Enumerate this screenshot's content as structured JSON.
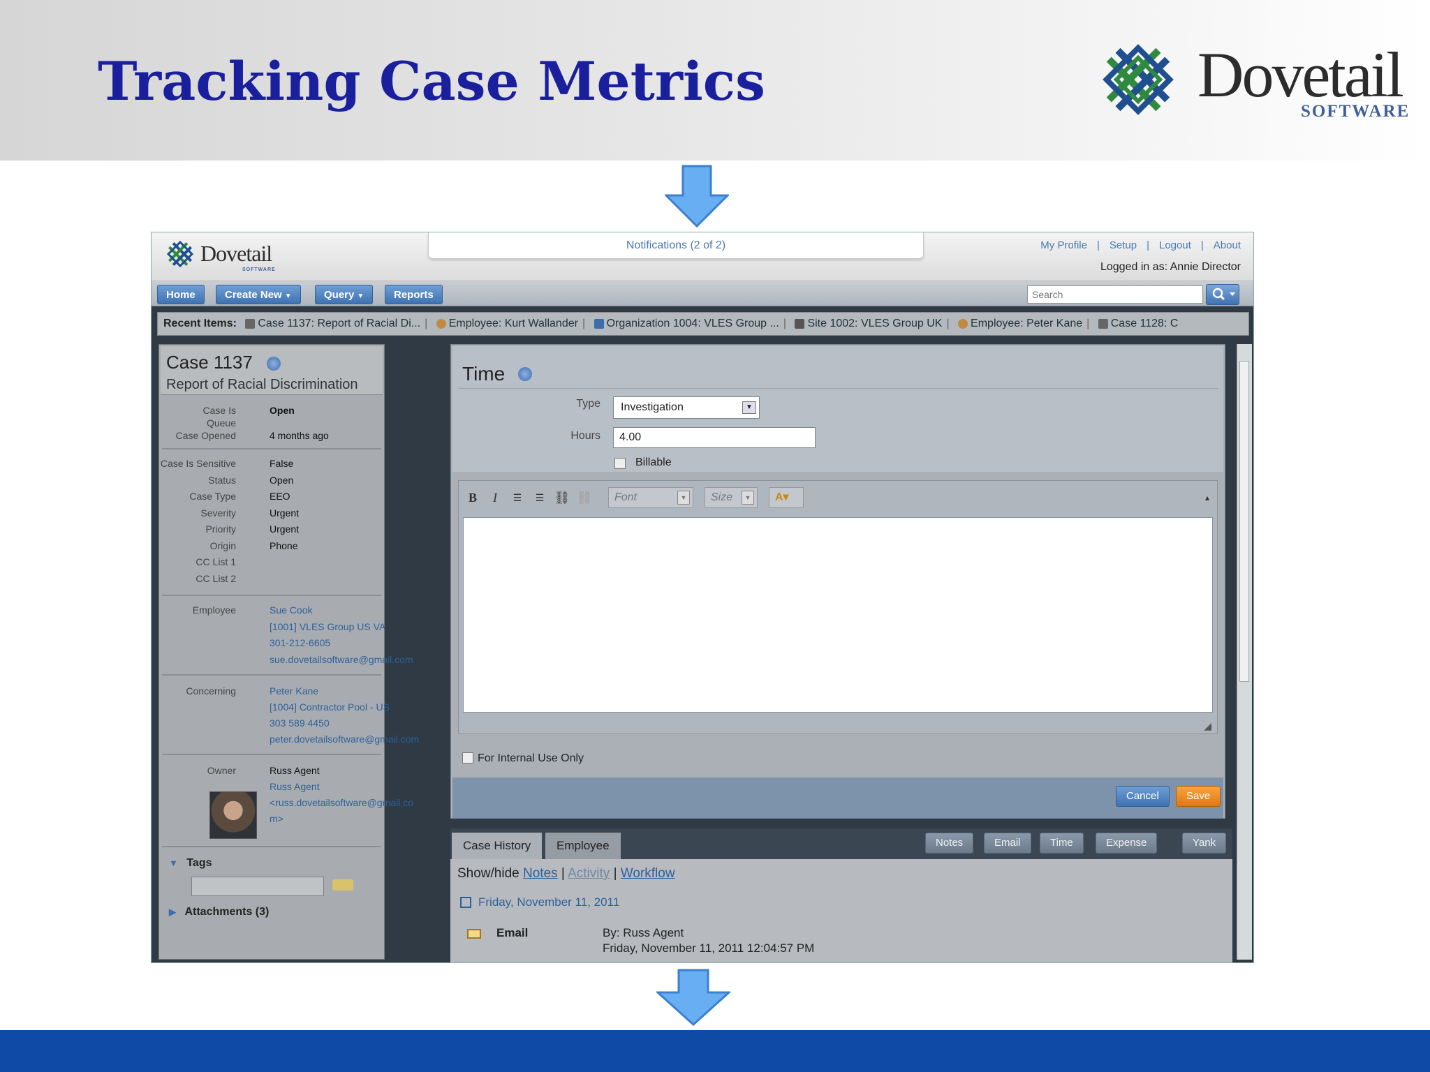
{
  "slide": {
    "title": "Tracking Case Metrics",
    "logo": {
      "name": "Dovetail",
      "sub": "SOFTWARE"
    },
    "colors": {
      "title": "#1a1f9e",
      "footer": "#0f4aa7",
      "arrow": "#5aa2ee"
    }
  },
  "app": {
    "logo": {
      "name": "Dovetail",
      "sub": "SOFTWARE"
    },
    "notifications": "Notifications (2 of 2)",
    "top_links": [
      "My Profile",
      "Setup",
      "Logout",
      "About"
    ],
    "logged_in": "Logged in as: Annie Director",
    "nav": {
      "home": "Home",
      "create_new": "Create New",
      "query": "Query",
      "reports": "Reports"
    },
    "search_placeholder": "Search",
    "recent": {
      "label": "Recent Items:",
      "items": [
        "Case 1137: Report of Racial Di...",
        "Employee: Kurt Wallander",
        "Organization 1004: VLES Group ...",
        "Site 1002: VLES Group UK",
        "Employee: Peter Kane",
        "Case 1128: C"
      ]
    },
    "case": {
      "number": "Case 1137",
      "title": "Report of Racial Discrimination",
      "fields": [
        {
          "k": "Case Is",
          "v": "Open"
        },
        {
          "k": "Queue",
          "v": ""
        },
        {
          "k": "Case Opened",
          "v": "4 months ago"
        },
        {
          "k": "Case Is Sensitive",
          "v": "False"
        },
        {
          "k": "Status",
          "v": "Open"
        },
        {
          "k": "Case Type",
          "v": "EEO"
        },
        {
          "k": "Severity",
          "v": "Urgent"
        },
        {
          "k": "Priority",
          "v": "Urgent"
        },
        {
          "k": "Origin",
          "v": "Phone"
        },
        {
          "k": "CC List 1",
          "v": ""
        },
        {
          "k": "CC List 2",
          "v": ""
        }
      ],
      "employee": {
        "label": "Employee",
        "lines": [
          "Sue Cook",
          "[1001] VLES Group US VA",
          "301-212-6605",
          "sue.dovetailsoftware@gmail.com"
        ]
      },
      "concerning": {
        "label": "Concerning",
        "lines": [
          "Peter Kane",
          "[1004] Contractor Pool - US",
          "303 589 4450",
          "peter.dovetailsoftware@gmail.com"
        ]
      },
      "owner": {
        "label": "Owner",
        "name": "Russ Agent",
        "lines": [
          "Russ Agent",
          "<russ.dovetailsoftware@gmail.co",
          "m>"
        ]
      },
      "tags_label": "Tags",
      "attachments_label": "Attachments (3)"
    },
    "time": {
      "title": "Time",
      "type_label": "Type",
      "type_value": "Investigation",
      "hours_label": "Hours",
      "hours_value": "4.00",
      "billable_label": "Billable",
      "font_placeholder": "Font",
      "size_placeholder": "Size",
      "internal_label": "For Internal Use Only",
      "cancel": "Cancel",
      "save": "Save"
    },
    "history": {
      "tabs": [
        "Case History",
        "Employee"
      ],
      "buttons": [
        "Notes",
        "Email",
        "Time",
        "Expense",
        "Yank"
      ],
      "showhide_label": "Show/hide",
      "links": [
        "Notes",
        "Activity",
        "Workflow"
      ],
      "date": "Friday, November 11, 2011",
      "entry": {
        "type": "Email",
        "by": "By: Russ Agent",
        "when": "Friday, November 11, 2011 12:04:57 PM"
      }
    }
  }
}
